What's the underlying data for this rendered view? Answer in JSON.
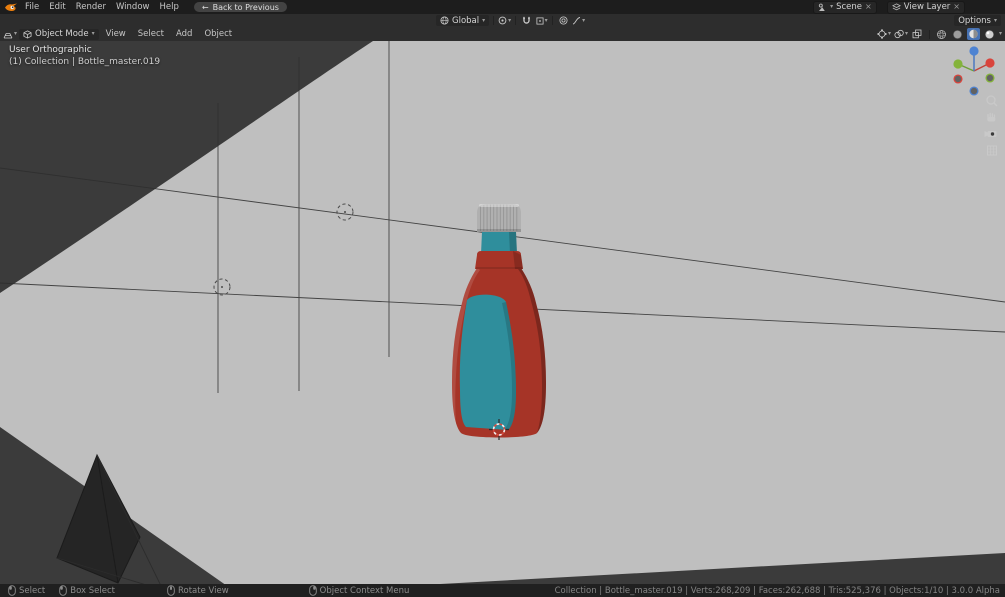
{
  "topbar": {
    "menus": [
      "File",
      "Edit",
      "Render",
      "Window",
      "Help"
    ],
    "back_button_label": "Back to Previous",
    "scene_label": "Scene",
    "view_layer_label": "View Layer"
  },
  "header": {
    "mode_label": "Object Mode",
    "menus": [
      "View",
      "Select",
      "Add",
      "Object"
    ],
    "orientation_label": "Global",
    "options_label": "Options"
  },
  "viewport": {
    "view_label": "User Orthographic",
    "collection_label": "(1) Collection | Bottle_master.019"
  },
  "statusbar": {
    "hints": [
      "Select",
      "Box Select",
      "Rotate View",
      "Object Context Menu"
    ],
    "stats": "Collection | Bottle_master.019 | Verts:268,209 | Faces:262,688 | Tris:525,376 | Objects:1/10 | 3.0.0 Alpha"
  },
  "colors": {
    "accent_blue": "#4772b3",
    "backdrop_light": "#bfbfbf",
    "viewport_bg": "#3b3b3b",
    "bottle_body_red": "#a63427",
    "bottle_label_teal": "#2f8e9c",
    "bottle_cap_gray": "#b0b0b0"
  }
}
